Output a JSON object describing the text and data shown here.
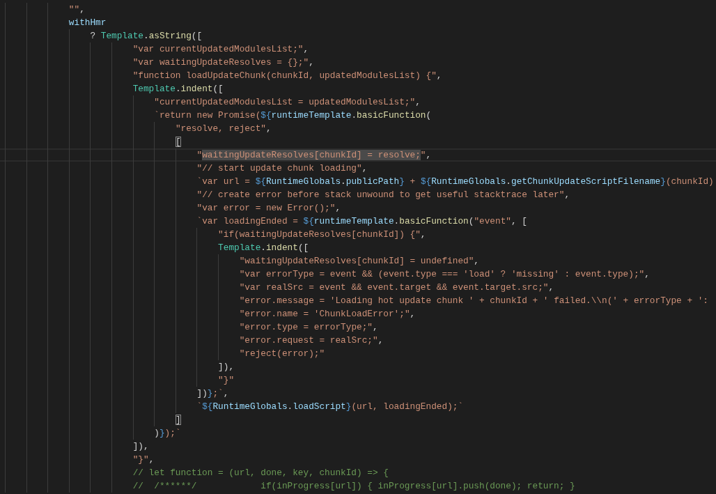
{
  "editor": {
    "lines": [
      {
        "current": false,
        "tokens": [
          {
            "kind": "string",
            "text": "            \"\""
          },
          {
            "kind": "punct",
            "text": ","
          }
        ]
      },
      {
        "current": false,
        "tokens": [
          {
            "kind": "variable",
            "text": "            withHmr"
          }
        ]
      },
      {
        "current": false,
        "tokens": [
          {
            "kind": "punct",
            "text": "                ? "
          },
          {
            "kind": "type",
            "text": "Template"
          },
          {
            "kind": "punct",
            "text": "."
          },
          {
            "kind": "function",
            "text": "asString"
          },
          {
            "kind": "punct",
            "text": "(["
          }
        ]
      },
      {
        "current": false,
        "tokens": [
          {
            "kind": "string",
            "text": "                        \"var currentUpdatedModulesList;\""
          },
          {
            "kind": "punct",
            "text": ","
          }
        ]
      },
      {
        "current": false,
        "tokens": [
          {
            "kind": "string",
            "text": "                        \"var waitingUpdateResolves = {};\""
          },
          {
            "kind": "punct",
            "text": ","
          }
        ]
      },
      {
        "current": false,
        "tokens": [
          {
            "kind": "string",
            "text": "                        \"function loadUpdateChunk(chunkId, updatedModulesList) {\""
          },
          {
            "kind": "punct",
            "text": ","
          }
        ]
      },
      {
        "current": false,
        "tokens": [
          {
            "kind": "type",
            "text": "                        Template"
          },
          {
            "kind": "punct",
            "text": "."
          },
          {
            "kind": "function",
            "text": "indent"
          },
          {
            "kind": "punct",
            "text": "(["
          }
        ]
      },
      {
        "current": false,
        "tokens": [
          {
            "kind": "string",
            "text": "                            \"currentUpdatedModulesList = updatedModulesList;\""
          },
          {
            "kind": "punct",
            "text": ","
          }
        ]
      },
      {
        "current": false,
        "tokens": [
          {
            "kind": "string",
            "text": "                            `return new Promise("
          },
          {
            "kind": "keyword",
            "text": "${"
          },
          {
            "kind": "variable",
            "text": "runtimeTemplate"
          },
          {
            "kind": "punct",
            "text": "."
          },
          {
            "kind": "function",
            "text": "basicFunction"
          },
          {
            "kind": "punct",
            "text": "("
          }
        ]
      },
      {
        "current": false,
        "tokens": [
          {
            "kind": "string",
            "text": "                                \"resolve, reject\""
          },
          {
            "kind": "punct",
            "text": ","
          }
        ]
      },
      {
        "current": false,
        "tokens": [
          {
            "kind": "bracket",
            "text": "                                ["
          }
        ]
      },
      {
        "current": true,
        "tokens": [
          {
            "kind": "string",
            "text": "                                    \""
          },
          {
            "kind": "selection",
            "text": "waitingUpdateResolves[chunkId] = resolve;"
          },
          {
            "kind": "string",
            "text": "\""
          },
          {
            "kind": "punct",
            "text": ","
          }
        ]
      },
      {
        "current": false,
        "tokens": [
          {
            "kind": "string",
            "text": "                                    \"// start update chunk loading\""
          },
          {
            "kind": "punct",
            "text": ","
          }
        ]
      },
      {
        "current": false,
        "tokens": [
          {
            "kind": "string",
            "text": "                                    `var url = "
          },
          {
            "kind": "keyword",
            "text": "${"
          },
          {
            "kind": "variable",
            "text": "RuntimeGlobals"
          },
          {
            "kind": "punct",
            "text": "."
          },
          {
            "kind": "variable",
            "text": "publicPath"
          },
          {
            "kind": "keyword",
            "text": "}"
          },
          {
            "kind": "string",
            "text": " + "
          },
          {
            "kind": "keyword",
            "text": "${"
          },
          {
            "kind": "variable",
            "text": "RuntimeGlobals"
          },
          {
            "kind": "punct",
            "text": "."
          },
          {
            "kind": "variable",
            "text": "getChunkUpdateScriptFilename"
          },
          {
            "kind": "keyword",
            "text": "}"
          },
          {
            "kind": "string",
            "text": "(chunkId)"
          }
        ]
      },
      {
        "current": false,
        "tokens": [
          {
            "kind": "string",
            "text": "                                    \"// create error before stack unwound to get useful stacktrace later\""
          },
          {
            "kind": "punct",
            "text": ","
          }
        ]
      },
      {
        "current": false,
        "tokens": [
          {
            "kind": "string",
            "text": "                                    \"var error = new Error();\""
          },
          {
            "kind": "punct",
            "text": ","
          }
        ]
      },
      {
        "current": false,
        "tokens": [
          {
            "kind": "string",
            "text": "                                    `var loadingEnded = "
          },
          {
            "kind": "keyword",
            "text": "${"
          },
          {
            "kind": "variable",
            "text": "runtimeTemplate"
          },
          {
            "kind": "punct",
            "text": "."
          },
          {
            "kind": "function",
            "text": "basicFunction"
          },
          {
            "kind": "punct",
            "text": "("
          },
          {
            "kind": "string",
            "text": "\"event\""
          },
          {
            "kind": "punct",
            "text": ", ["
          }
        ]
      },
      {
        "current": false,
        "tokens": [
          {
            "kind": "string",
            "text": "                                        \"if(waitingUpdateResolves[chunkId]) {\""
          },
          {
            "kind": "punct",
            "text": ","
          }
        ]
      },
      {
        "current": false,
        "tokens": [
          {
            "kind": "type",
            "text": "                                        Template"
          },
          {
            "kind": "punct",
            "text": "."
          },
          {
            "kind": "function",
            "text": "indent"
          },
          {
            "kind": "punct",
            "text": "(["
          }
        ]
      },
      {
        "current": false,
        "tokens": [
          {
            "kind": "string",
            "text": "                                            \"waitingUpdateResolves[chunkId] = undefined\""
          },
          {
            "kind": "punct",
            "text": ","
          }
        ]
      },
      {
        "current": false,
        "tokens": [
          {
            "kind": "string",
            "text": "                                            \"var errorType = event && (event.type === 'load' ? 'missing' : event.type);\""
          },
          {
            "kind": "punct",
            "text": ","
          }
        ]
      },
      {
        "current": false,
        "tokens": [
          {
            "kind": "string",
            "text": "                                            \"var realSrc = event && event.target && event.target.src;\""
          },
          {
            "kind": "punct",
            "text": ","
          }
        ]
      },
      {
        "current": false,
        "tokens": [
          {
            "kind": "string",
            "text": "                                            \"error.message = 'Loading hot update chunk ' + chunkId + ' failed.\\\\n(' + errorType + ':"
          }
        ]
      },
      {
        "current": false,
        "tokens": [
          {
            "kind": "string",
            "text": "                                            \"error.name = 'ChunkLoadError';\""
          },
          {
            "kind": "punct",
            "text": ","
          }
        ]
      },
      {
        "current": false,
        "tokens": [
          {
            "kind": "string",
            "text": "                                            \"error.type = errorType;\""
          },
          {
            "kind": "punct",
            "text": ","
          }
        ]
      },
      {
        "current": false,
        "tokens": [
          {
            "kind": "string",
            "text": "                                            \"error.request = realSrc;\""
          },
          {
            "kind": "punct",
            "text": ","
          }
        ]
      },
      {
        "current": false,
        "tokens": [
          {
            "kind": "string",
            "text": "                                            \"reject(error);\""
          }
        ]
      },
      {
        "current": false,
        "tokens": [
          {
            "kind": "punct",
            "text": "                                        ]),"
          }
        ]
      },
      {
        "current": false,
        "tokens": [
          {
            "kind": "string",
            "text": "                                        \"}\""
          }
        ]
      },
      {
        "current": false,
        "tokens": [
          {
            "kind": "punct",
            "text": "                                    ])"
          },
          {
            "kind": "keyword",
            "text": "}"
          },
          {
            "kind": "string",
            "text": ";`"
          },
          {
            "kind": "punct",
            "text": ","
          }
        ]
      },
      {
        "current": false,
        "tokens": [
          {
            "kind": "string",
            "text": "                                    `"
          },
          {
            "kind": "keyword",
            "text": "${"
          },
          {
            "kind": "variable",
            "text": "RuntimeGlobals"
          },
          {
            "kind": "punct",
            "text": "."
          },
          {
            "kind": "variable",
            "text": "loadScript"
          },
          {
            "kind": "keyword",
            "text": "}"
          },
          {
            "kind": "string",
            "text": "(url, loadingEnded);`"
          }
        ]
      },
      {
        "current": false,
        "tokens": [
          {
            "kind": "bracket",
            "text": "                                ]"
          }
        ]
      },
      {
        "current": false,
        "tokens": [
          {
            "kind": "punct",
            "text": "                            )"
          },
          {
            "kind": "keyword",
            "text": "}"
          },
          {
            "kind": "string",
            "text": ");`"
          }
        ]
      },
      {
        "current": false,
        "tokens": [
          {
            "kind": "punct",
            "text": "                        ]),"
          }
        ]
      },
      {
        "current": false,
        "tokens": [
          {
            "kind": "string",
            "text": "                        \"}\""
          },
          {
            "kind": "punct",
            "text": ","
          }
        ]
      },
      {
        "current": false,
        "tokens": [
          {
            "kind": "comment",
            "text": "                        // let function = (url, done, key, chunkId) => {"
          }
        ]
      },
      {
        "current": false,
        "tokens": [
          {
            "kind": "comment",
            "text": "                        //  /******/            if(inProgress[url]) { inProgress[url].push(done); return; }"
          }
        ]
      }
    ]
  }
}
